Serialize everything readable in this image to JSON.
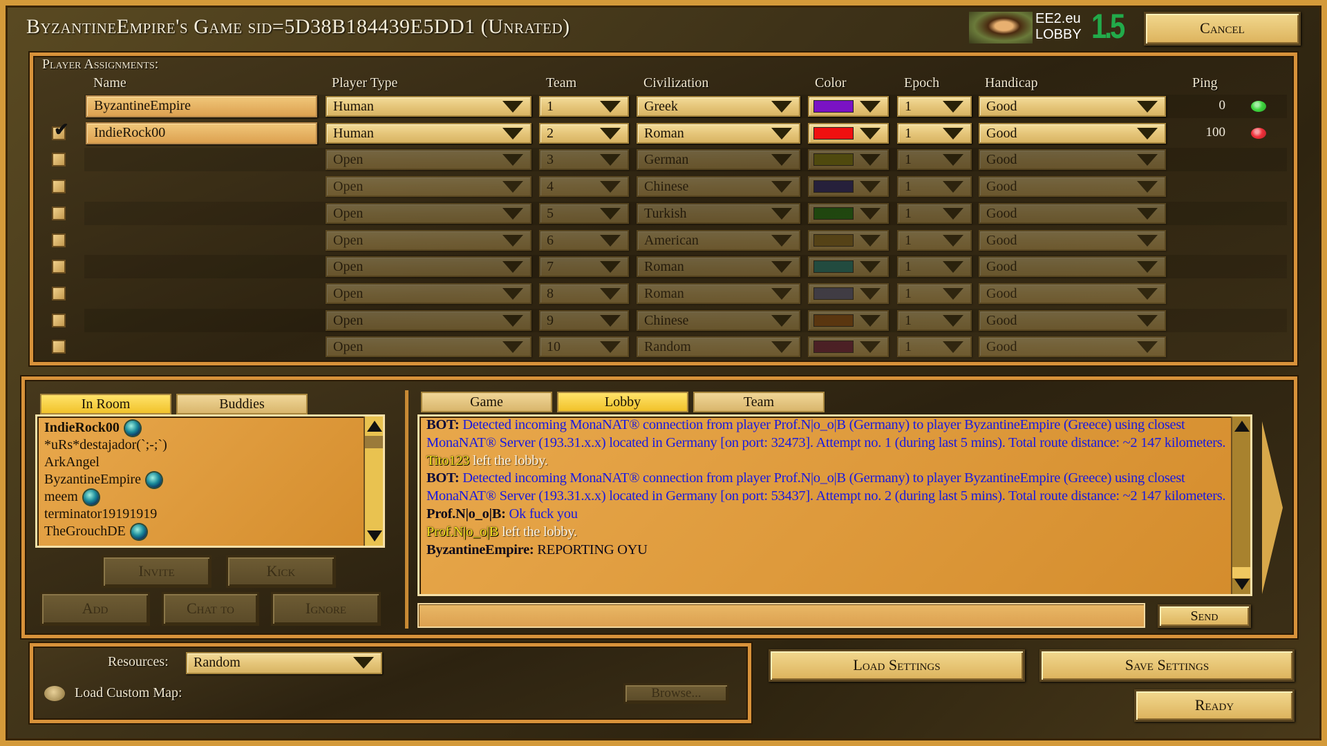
{
  "title": "ByzantineEmpire's Game sid=5D38B184439E5DD1 (Unrated)",
  "logo": {
    "line1": "EE2.eu",
    "line2": "LOBBY",
    "version": "1.5",
    "version_color": "#22aa4a"
  },
  "cancel_label": "Cancel",
  "players": {
    "section_label": "Player Assignments:",
    "headers": {
      "name": "Name",
      "type": "Player Type",
      "team": "Team",
      "civ": "Civilization",
      "color": "Color",
      "epoch": "Epoch",
      "handicap": "Handicap",
      "ping": "Ping"
    },
    "rows": [
      {
        "checked": null,
        "name": "ByzantineEmpire",
        "type": "Human",
        "team": "1",
        "civ": "Greek",
        "color": "#7a12c4",
        "epoch": "1",
        "handicap": "Good",
        "ping": "0",
        "status": "#3ed63e",
        "active": true
      },
      {
        "checked": true,
        "name": "IndieRock00",
        "type": "Human",
        "team": "2",
        "civ": "Roman",
        "color": "#f01010",
        "epoch": "1",
        "handicap": "Good",
        "ping": "100",
        "status": "#f0303a",
        "active": true
      },
      {
        "checked": false,
        "name": "",
        "type": "Open",
        "team": "3",
        "civ": "German",
        "color": "#9a9a10",
        "epoch": "1",
        "handicap": "Good",
        "active": false
      },
      {
        "checked": false,
        "name": "",
        "type": "Open",
        "team": "4",
        "civ": "Chinese",
        "color": "#1a1a8a",
        "epoch": "1",
        "handicap": "Good",
        "active": false
      },
      {
        "checked": false,
        "name": "",
        "type": "Open",
        "team": "5",
        "civ": "Turkish",
        "color": "#129012",
        "epoch": "1",
        "handicap": "Good",
        "active": false
      },
      {
        "checked": false,
        "name": "",
        "type": "Open",
        "team": "6",
        "civ": "American",
        "color": "#9a7a22",
        "epoch": "1",
        "handicap": "Good",
        "active": false
      },
      {
        "checked": false,
        "name": "",
        "type": "Open",
        "team": "7",
        "civ": "Roman",
        "color": "#129a9a",
        "epoch": "1",
        "handicap": "Good",
        "active": false
      },
      {
        "checked": false,
        "name": "",
        "type": "Open",
        "team": "8",
        "civ": "Roman",
        "color": "#5a64a0",
        "epoch": "1",
        "handicap": "Good",
        "active": false
      },
      {
        "checked": false,
        "name": "",
        "type": "Open",
        "team": "9",
        "civ": "Chinese",
        "color": "#b05a10",
        "epoch": "1",
        "handicap": "Good",
        "active": false
      },
      {
        "checked": false,
        "name": "",
        "type": "Open",
        "team": "10",
        "civ": "Random",
        "color": "#7a1248",
        "epoch": "1",
        "handicap": "Good",
        "active": false
      }
    ]
  },
  "people": {
    "tabs": [
      {
        "label": "In Room",
        "active": true
      },
      {
        "label": "Buddies",
        "active": false
      }
    ],
    "list": [
      {
        "name": "IndieRock00",
        "bold": true,
        "globe": true
      },
      {
        "name": "*uRs*destajador(`;-;`)",
        "globe": false
      },
      {
        "name": "ArkAngel",
        "globe": false
      },
      {
        "name": "ByzantineEmpire",
        "globe": true
      },
      {
        "name": "meem",
        "globe": true
      },
      {
        "name": "terminator19191919",
        "globe": false
      },
      {
        "name": "TheGrouchDE",
        "globe": true
      }
    ],
    "buttons": {
      "invite": "Invite",
      "kick": "Kick",
      "add": "Add",
      "chat_to": "Chat to",
      "ignore": "Ignore"
    }
  },
  "chat": {
    "tabs": [
      {
        "label": "Game",
        "active": false
      },
      {
        "label": "Lobby",
        "active": true
      },
      {
        "label": "Team",
        "active": false
      }
    ],
    "messages": [
      [
        {
          "t": "BOT:",
          "c": "bot"
        },
        {
          "t": " Detected incoming MonaNAT® connection from player Prof.N|o_o|B (Germany) to player ByzantineEmpire (Greece) using closest MonaNAT® Server (193.31.x.x) located in Germany [on port: 32473]. Attempt no. 1 (during last 5 mins). Total route distance: ~2 147 kilometers.",
          "c": "bl"
        }
      ],
      [
        {
          "t": "Tito123",
          "c": "yn"
        },
        {
          "t": " left the lobby.",
          "c": "wt"
        }
      ],
      [
        {
          "t": "BOT:",
          "c": "bot"
        },
        {
          "t": " Detected incoming MonaNAT® connection from player Prof.N|o_o|B (Germany) to player ByzantineEmpire (Greece) using closest MonaNAT® Server (193.31.x.x) located in Germany [on port: 53437]. Attempt no. 2 (during last 5 mins). Total route distance: ~2 147 kilometers.",
          "c": "bl"
        }
      ],
      [
        {
          "t": "Prof.N|o_o|B:",
          "c": "dk"
        },
        {
          "t": " Ok fuck you",
          "c": "bl"
        }
      ],
      [
        {
          "t": "Prof.N|o_o|B",
          "c": "yn"
        },
        {
          "t": " left the lobby.",
          "c": "wt"
        }
      ],
      [
        {
          "t": "ByzantineEmpire:",
          "c": "dk"
        },
        {
          "t": " REPORTING OYU",
          "c": "dt"
        }
      ]
    ],
    "input_value": "",
    "send_label": "Send"
  },
  "settings": {
    "resources_label": "Resources:",
    "resources_value": "Random",
    "custom_map_label": "Load Custom Map:",
    "browse_label": "Browse...",
    "load_label": "Load Settings",
    "save_label": "Save Settings",
    "ready_label": "Ready"
  }
}
